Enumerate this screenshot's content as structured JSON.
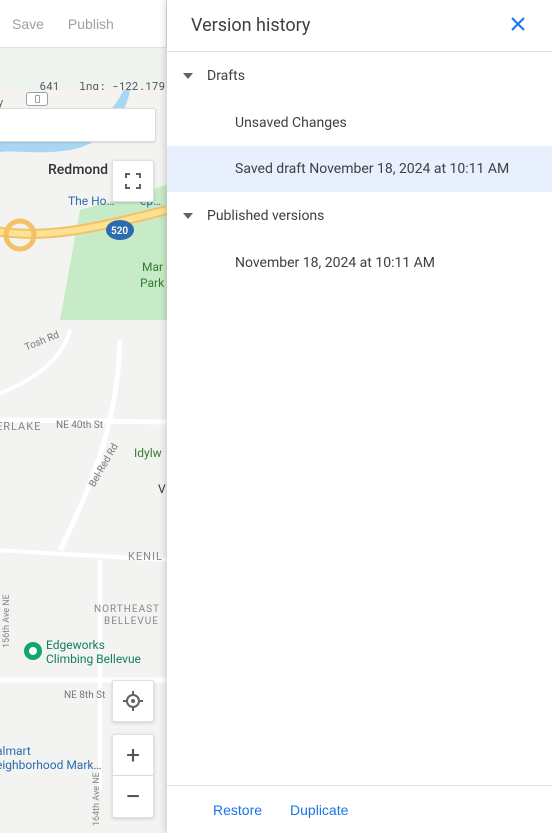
{
  "toolbar": {
    "save": "Save",
    "publish": "Publish"
  },
  "coords": {
    "lat_label": "641",
    "lng_label": "lng:",
    "lng_value": "-122.179"
  },
  "map_labels": {
    "redmond": "Redmond",
    "ry_suffix": "ry",
    "home": "The Ho…",
    "home2": "ep…",
    "marymoor_part": "Mar",
    "park": "Park",
    "tosh": "Tosh Rd",
    "erlake": "ERLAKE",
    "ne40": "NE 40th St",
    "belred": "Bel-Red Rd",
    "idylw": "Idylw",
    "v": "V",
    "kenil": "KENIL",
    "ne_bellevue1": "NORTHEAST",
    "ne_bellevue2": "BELLEVUE",
    "edgeworks1": "Edgeworks",
    "edgeworks2": "Climbing Bellevue",
    "ne8": "NE 8th St",
    "almart": "almart",
    "neigh": "eighborhood Mark…",
    "ave16": "164th Ave NE",
    "ave15": "156th Ave NE",
    "hwy520": "520"
  },
  "zoom": {
    "in": "+",
    "out": "−"
  },
  "panel": {
    "title": "Version history",
    "sections": {
      "drafts": {
        "label": "Drafts",
        "items": [
          {
            "label": "Unsaved Changes",
            "selected": false
          },
          {
            "label": "Saved draft November 18, 2024 at 10:11 AM",
            "selected": true
          }
        ]
      },
      "published": {
        "label": "Published versions",
        "items": [
          {
            "label": "November 18, 2024 at 10:11 AM",
            "selected": false
          }
        ]
      }
    },
    "footer": {
      "restore": "Restore",
      "duplicate": "Duplicate"
    }
  },
  "colors": {
    "accent": "#1a73e8"
  }
}
